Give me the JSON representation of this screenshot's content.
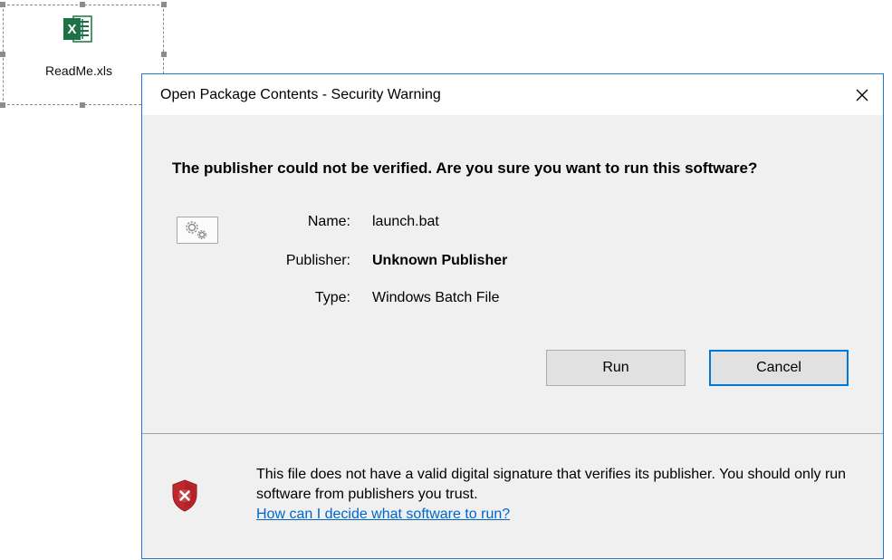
{
  "embedded_object": {
    "filename": "ReadMe.xls",
    "icon": "excel-icon"
  },
  "dialog": {
    "title": "Open Package Contents - Security Warning",
    "close_glyph": "✕",
    "heading": "The publisher could not be verified.  Are you sure you want to run this software?",
    "file_icon": "gears-icon",
    "fields": {
      "name_label": "Name:",
      "name_value": "launch.bat",
      "publisher_label": "Publisher:",
      "publisher_value": "Unknown Publisher",
      "type_label": "Type:",
      "type_value": "Windows Batch File"
    },
    "buttons": {
      "run": "Run",
      "cancel": "Cancel"
    },
    "footer": {
      "icon": "shield-error-icon",
      "message": "This file does not have a valid digital signature that verifies its publisher.  You should only run software from publishers you trust.",
      "link": "How can I decide what software to run?"
    }
  },
  "colors": {
    "dialog_border": "#1e78d4",
    "dialog_bg": "#f0f0f0",
    "link": "#0066cc",
    "default_button_border": "#0078d7",
    "excel_green": "#1e7145",
    "shield_red": "#c0272d"
  }
}
